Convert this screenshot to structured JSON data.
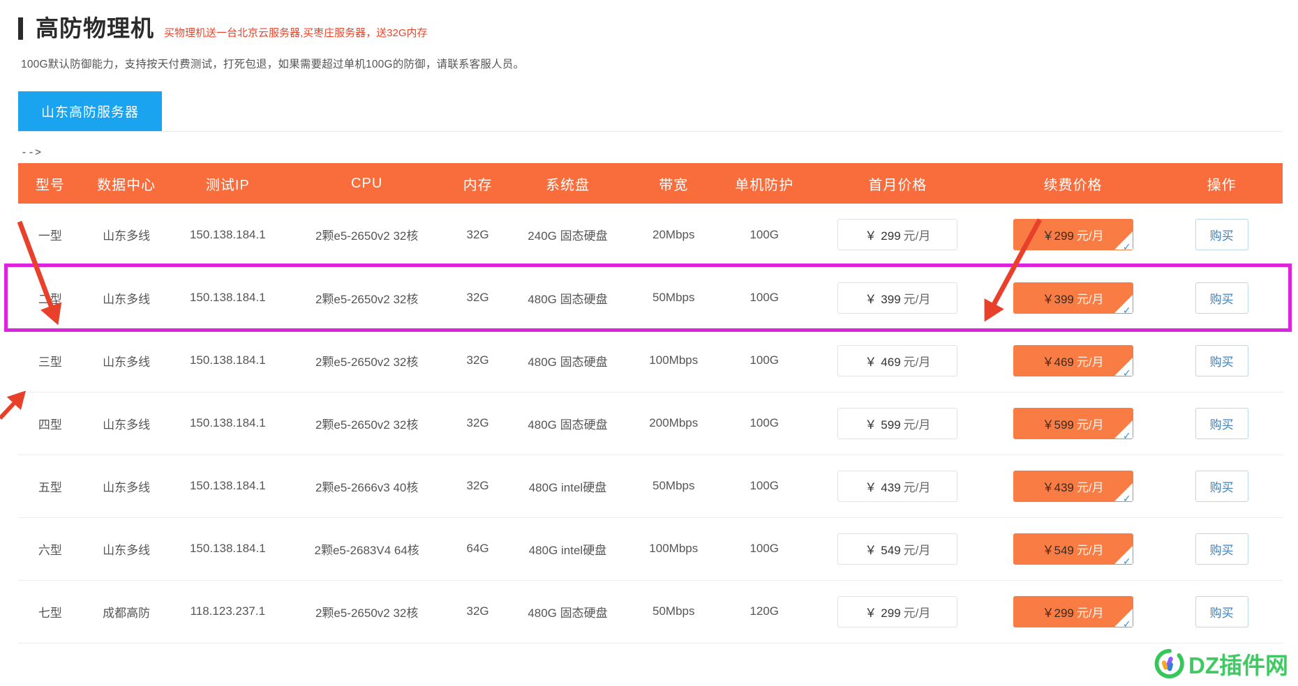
{
  "header": {
    "title": "高防物理机",
    "promo": "买物理机送一台北京云服务器,买枣庄服务器，送32G内存",
    "description": "100G默认防御能力，支持按天付费测试，打死包退，如果需要超过单机100G的防御，请联系客服人员。"
  },
  "tabs": [
    {
      "label": "山东高防服务器",
      "active": true
    }
  ],
  "stray_comment": "-->",
  "table": {
    "columns": [
      "型号",
      "数据中心",
      "测试IP",
      "CPU",
      "内存",
      "系统盘",
      "带宽",
      "单机防护",
      "首月价格",
      "续费价格",
      "操作"
    ],
    "currency_symbol": "￥",
    "price_unit": "元/月",
    "buy_label": "购买",
    "rows": [
      {
        "model": "一型",
        "datacenter": "山东多线",
        "test_ip": "150.138.184.1",
        "cpu": "2颗e5-2650v2 32核",
        "memory": "32G",
        "disk": "240G 固态硬盘",
        "bandwidth": "20Mbps",
        "defense": "100G",
        "first_month_price": "299",
        "renew_price": "299"
      },
      {
        "model": "二型",
        "datacenter": "山东多线",
        "test_ip": "150.138.184.1",
        "cpu": "2颗e5-2650v2 32核",
        "memory": "32G",
        "disk": "480G 固态硬盘",
        "bandwidth": "50Mbps",
        "defense": "100G",
        "first_month_price": "399",
        "renew_price": "399"
      },
      {
        "model": "三型",
        "datacenter": "山东多线",
        "test_ip": "150.138.184.1",
        "cpu": "2颗e5-2650v2 32核",
        "memory": "32G",
        "disk": "480G 固态硬盘",
        "bandwidth": "100Mbps",
        "defense": "100G",
        "first_month_price": "469",
        "renew_price": "469"
      },
      {
        "model": "四型",
        "datacenter": "山东多线",
        "test_ip": "150.138.184.1",
        "cpu": "2颗e5-2650v2 32核",
        "memory": "32G",
        "disk": "480G 固态硬盘",
        "bandwidth": "200Mbps",
        "defense": "100G",
        "first_month_price": "599",
        "renew_price": "599"
      },
      {
        "model": "五型",
        "datacenter": "山东多线",
        "test_ip": "150.138.184.1",
        "cpu": "2颗e5-2666v3 40核",
        "memory": "32G",
        "disk": "480G intel硬盘",
        "bandwidth": "50Mbps",
        "defense": "100G",
        "first_month_price": "439",
        "renew_price": "439"
      },
      {
        "model": "六型",
        "datacenter": "山东多线",
        "test_ip": "150.138.184.1",
        "cpu": "2颗e5-2683V4 64核",
        "memory": "64G",
        "disk": "480G intel硬盘",
        "bandwidth": "100Mbps",
        "defense": "100G",
        "first_month_price": "549",
        "renew_price": "549"
      },
      {
        "model": "七型",
        "datacenter": "成都高防",
        "test_ip": "118.123.237.1",
        "cpu": "2颗e5-2650v2 32核",
        "memory": "32G",
        "disk": "480G 固态硬盘",
        "bandwidth": "50Mbps",
        "defense": "120G",
        "first_month_price": "299",
        "renew_price": "299"
      }
    ],
    "highlighted_row_index": 1
  },
  "annotations": {
    "highlight_color": "#dd23dd",
    "arrow_color": "#e8402a",
    "arrow_count": 3
  },
  "watermark": {
    "text": "DZ插件网",
    "color": "#35c759"
  },
  "colors": {
    "table_header_bg": "#f96c3c",
    "tab_active_bg": "#1aa3ef",
    "renew_tag_bg": "#f87c43",
    "buy_btn_text": "#3f7fbe",
    "promo_text": "#e8452c"
  }
}
